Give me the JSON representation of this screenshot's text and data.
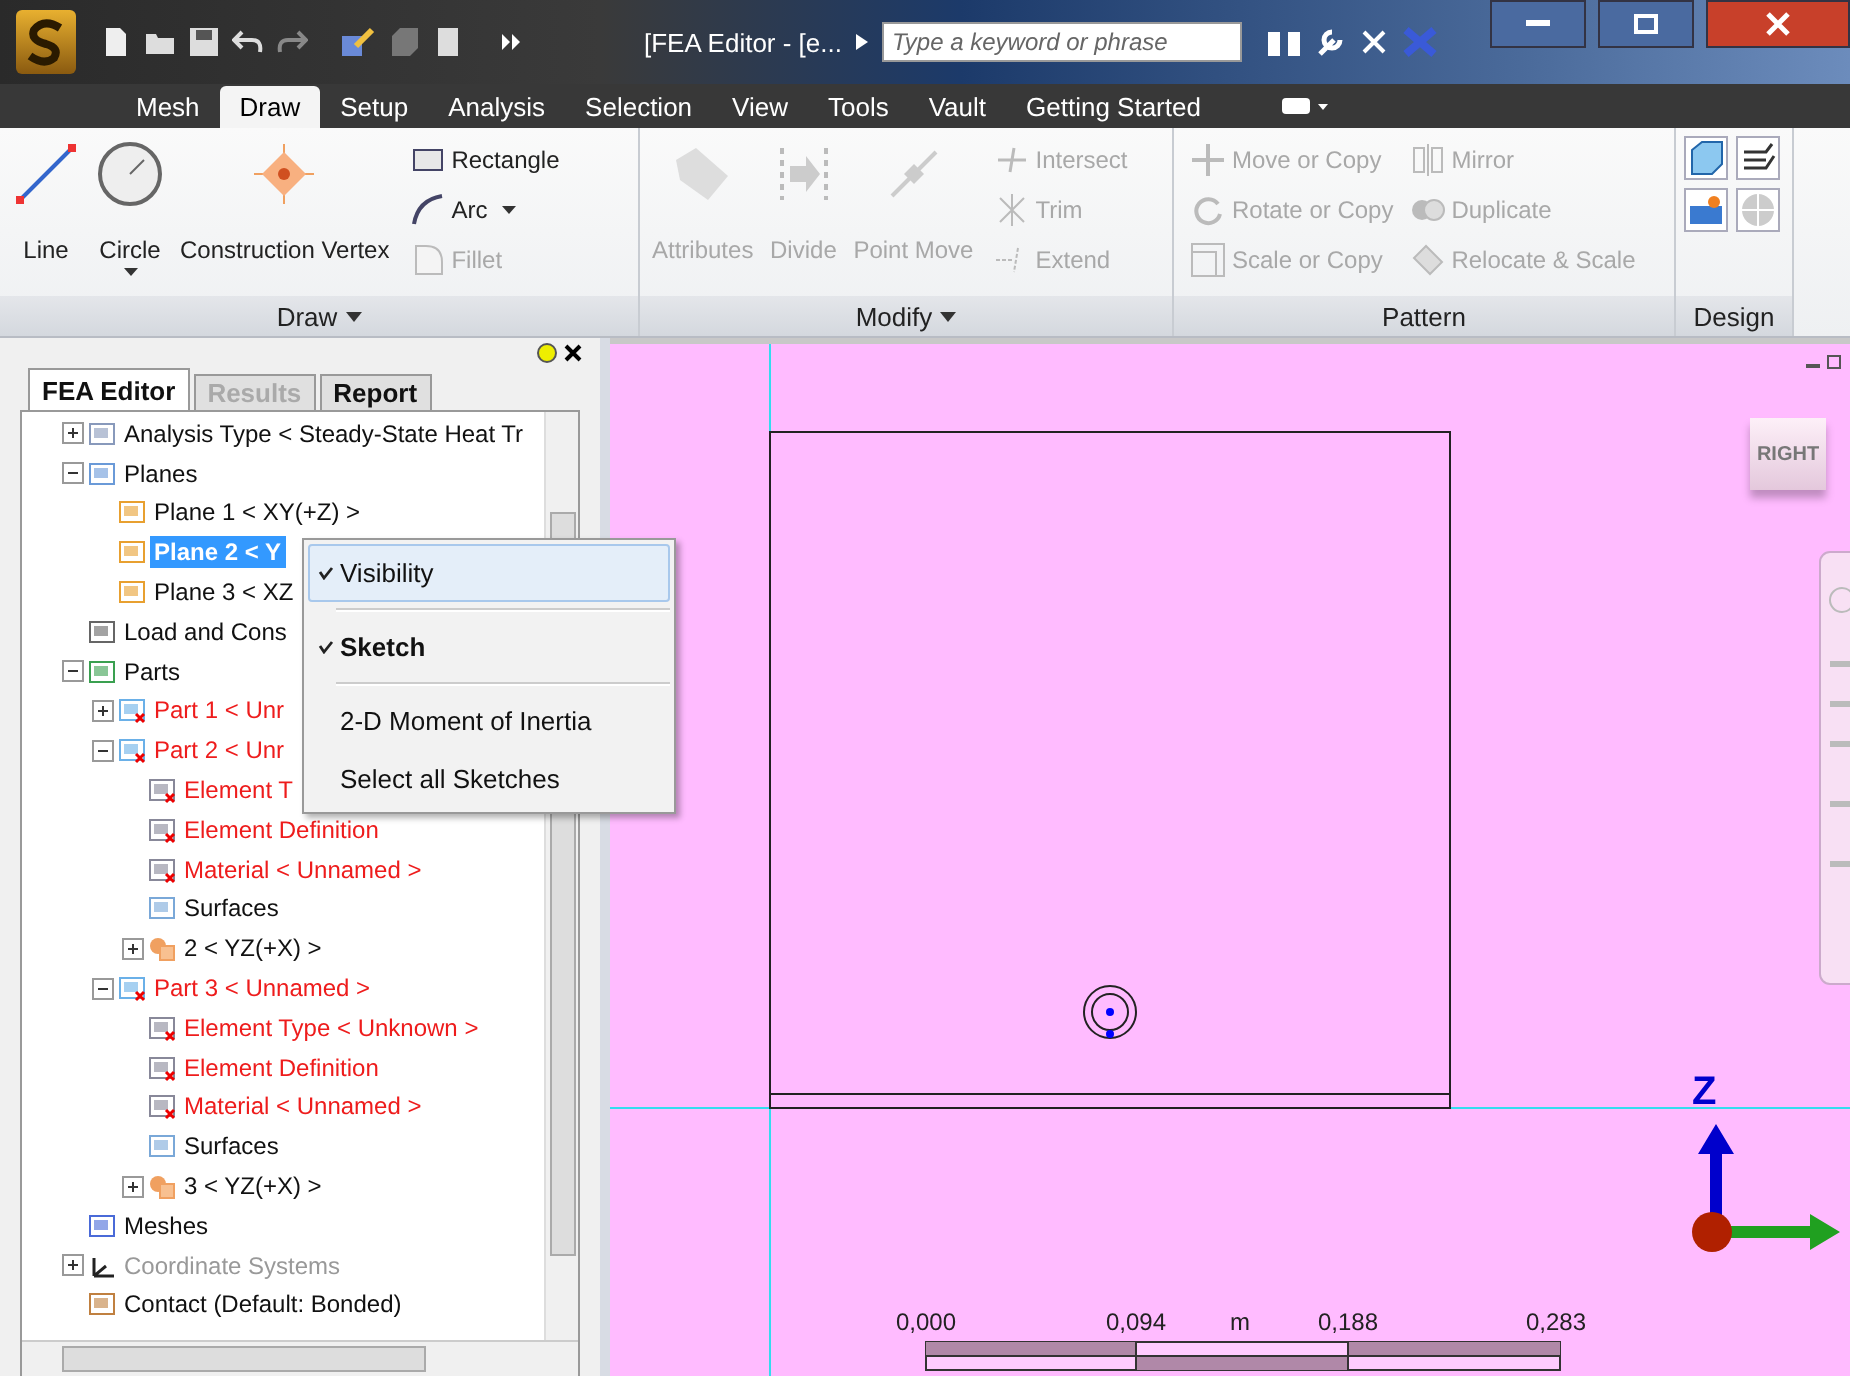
{
  "window": {
    "title": "[FEA Editor - [e...",
    "search": {
      "placeholder": "Type a keyword or phrase"
    }
  },
  "ribbon": {
    "tabs": [
      {
        "label": "Mesh",
        "selected": false
      },
      {
        "label": "Draw",
        "selected": true
      },
      {
        "label": "Setup",
        "selected": false
      },
      {
        "label": "Analysis",
        "selected": false
      },
      {
        "label": "Selection",
        "selected": false
      },
      {
        "label": "View",
        "selected": false
      },
      {
        "label": "Tools",
        "selected": false
      },
      {
        "label": "Vault",
        "selected": false
      },
      {
        "label": "Getting Started",
        "selected": false
      }
    ],
    "groups": [
      {
        "title": "Draw",
        "menu": true,
        "large": [
          {
            "label": "Line",
            "kind": "line",
            "disabled": false,
            "dropdown": false
          },
          {
            "label": "Circle",
            "kind": "circle",
            "disabled": false,
            "dropdown": true
          },
          {
            "label": "Construction Vertex",
            "kind": "vertex",
            "disabled": false,
            "dropdown": false
          }
        ],
        "small": [
          {
            "label": "Rectangle",
            "kind": "rectangle",
            "disabled": false,
            "dropdown": false
          },
          {
            "label": "Arc",
            "kind": "arc",
            "disabled": false,
            "dropdown": true
          },
          {
            "label": "Fillet",
            "kind": "fillet",
            "disabled": true,
            "dropdown": false
          }
        ]
      },
      {
        "title": "Modify",
        "menu": true,
        "large": [
          {
            "label": "Attributes",
            "kind": "tag",
            "disabled": true,
            "dropdown": false
          },
          {
            "label": "Divide",
            "kind": "divide",
            "disabled": true,
            "dropdown": false
          },
          {
            "label": "Point Move",
            "kind": "point-move",
            "disabled": true,
            "dropdown": false
          }
        ],
        "small": [
          {
            "label": "Intersect",
            "kind": "intersect",
            "disabled": true,
            "dropdown": false
          },
          {
            "label": "Trim",
            "kind": "trim",
            "disabled": true,
            "dropdown": false
          },
          {
            "label": "Extend",
            "kind": "extend",
            "disabled": true,
            "dropdown": false
          }
        ]
      },
      {
        "title": "Pattern",
        "menu": false,
        "small": [
          {
            "label": "Move or Copy",
            "kind": "move",
            "disabled": true,
            "dropdown": false
          },
          {
            "label": "Rotate or Copy",
            "kind": "rotate",
            "disabled": true,
            "dropdown": false
          },
          {
            "label": "Scale or Copy",
            "kind": "scale",
            "disabled": true,
            "dropdown": false
          },
          {
            "label": "Mirror",
            "kind": "mirror",
            "disabled": true,
            "dropdown": false
          },
          {
            "label": "Duplicate",
            "kind": "duplicate",
            "disabled": true,
            "dropdown": false
          },
          {
            "label": "Relocate & Scale",
            "kind": "relocate",
            "disabled": true,
            "dropdown": false
          }
        ]
      },
      {
        "title": "Design",
        "menu": false,
        "small": [
          {
            "kind": "cube",
            "disabled": false
          },
          {
            "kind": "layers",
            "disabled": false
          },
          {
            "kind": "palette",
            "disabled": false
          },
          {
            "kind": "sphere",
            "disabled": false
          }
        ]
      }
    ]
  },
  "panel": {
    "tabs": [
      {
        "label": "FEA Editor",
        "selected": true,
        "disabled": false
      },
      {
        "label": "Results",
        "selected": false,
        "disabled": true
      },
      {
        "label": "Report",
        "selected": false,
        "disabled": false
      }
    ],
    "tree": [
      {
        "label": "Analysis Type < Steady-State Heat Tr",
        "kind": "sheet",
        "expanded": false,
        "selected": false,
        "error": false,
        "disabled": false
      },
      {
        "label": "Planes",
        "kind": "planes",
        "expanded": true,
        "selected": false,
        "error": false,
        "disabled": false,
        "children": [
          {
            "label": "Plane 1 < XY(+Z) >",
            "kind": "plane",
            "selected": false,
            "error": false,
            "disabled": false
          },
          {
            "label": "Plane 2 < Y",
            "kind": "plane",
            "selected": true,
            "error": false,
            "disabled": false
          },
          {
            "label": "Plane 3 < XZ",
            "kind": "plane",
            "selected": false,
            "error": false,
            "disabled": false
          }
        ]
      },
      {
        "label": "Load and Cons",
        "kind": "load",
        "selected": false,
        "error": false,
        "disabled": false
      },
      {
        "label": "Parts",
        "kind": "parts",
        "expanded": true,
        "selected": false,
        "error": false,
        "disabled": false,
        "children": [
          {
            "label": "Part 1 < Unr",
            "kind": "part",
            "expanded": false,
            "selected": false,
            "error": true,
            "disabled": false
          },
          {
            "label": "Part 2 < Unr",
            "kind": "part",
            "expanded": true,
            "selected": false,
            "error": true,
            "disabled": false,
            "children": [
              {
                "label": "Element T",
                "kind": "element",
                "selected": false,
                "error": true,
                "disabled": false
              },
              {
                "label": "Element Definition",
                "kind": "element",
                "selected": false,
                "error": true,
                "disabled": false
              },
              {
                "label": "Material < Unnamed >",
                "kind": "element",
                "selected": false,
                "error": true,
                "disabled": false
              },
              {
                "label": "Surfaces",
                "kind": "surfaces",
                "selected": false,
                "error": false,
                "disabled": false
              },
              {
                "label": "2 < YZ(+X) >",
                "kind": "body",
                "expanded": false,
                "selected": false,
                "error": false,
                "disabled": false
              }
            ]
          },
          {
            "label": "Part 3 < Unnamed >",
            "kind": "part",
            "expanded": true,
            "selected": false,
            "error": true,
            "disabled": false,
            "children": [
              {
                "label": "Element Type < Unknown >",
                "kind": "element",
                "selected": false,
                "error": true,
                "disabled": false
              },
              {
                "label": "Element Definition",
                "kind": "element",
                "selected": false,
                "error": true,
                "disabled": false
              },
              {
                "label": "Material < Unnamed >",
                "kind": "element",
                "selected": false,
                "error": true,
                "disabled": false
              },
              {
                "label": "Surfaces",
                "kind": "surfaces",
                "selected": false,
                "error": false,
                "disabled": false
              },
              {
                "label": "3 < YZ(+X) >",
                "kind": "body",
                "expanded": false,
                "selected": false,
                "error": false,
                "disabled": false
              }
            ]
          }
        ]
      },
      {
        "label": "Meshes",
        "kind": "meshes",
        "selected": false,
        "error": false,
        "disabled": false
      },
      {
        "label": "Coordinate Systems",
        "kind": "axes",
        "expanded": false,
        "selected": false,
        "error": false,
        "disabled": true
      },
      {
        "label": "Contact (Default: Bonded)",
        "kind": "contact",
        "selected": false,
        "error": false,
        "disabled": false
      }
    ]
  },
  "context_menu": [
    {
      "label": "Visibility",
      "checked": true,
      "selected": true,
      "bold": false
    },
    {
      "label": "Sketch",
      "checked": true,
      "selected": false,
      "bold": true
    },
    {
      "label": "2-D Moment of Inertia",
      "checked": false,
      "selected": false,
      "bold": false
    },
    {
      "label": "Select all Sketches",
      "checked": false,
      "selected": false,
      "bold": false
    }
  ],
  "viewport": {
    "view_cube": "RIGHT",
    "axis_label": "Z",
    "scale": {
      "labels": [
        "0,000",
        "0,094",
        "0,188",
        "0,283"
      ],
      "unit": "m"
    }
  }
}
